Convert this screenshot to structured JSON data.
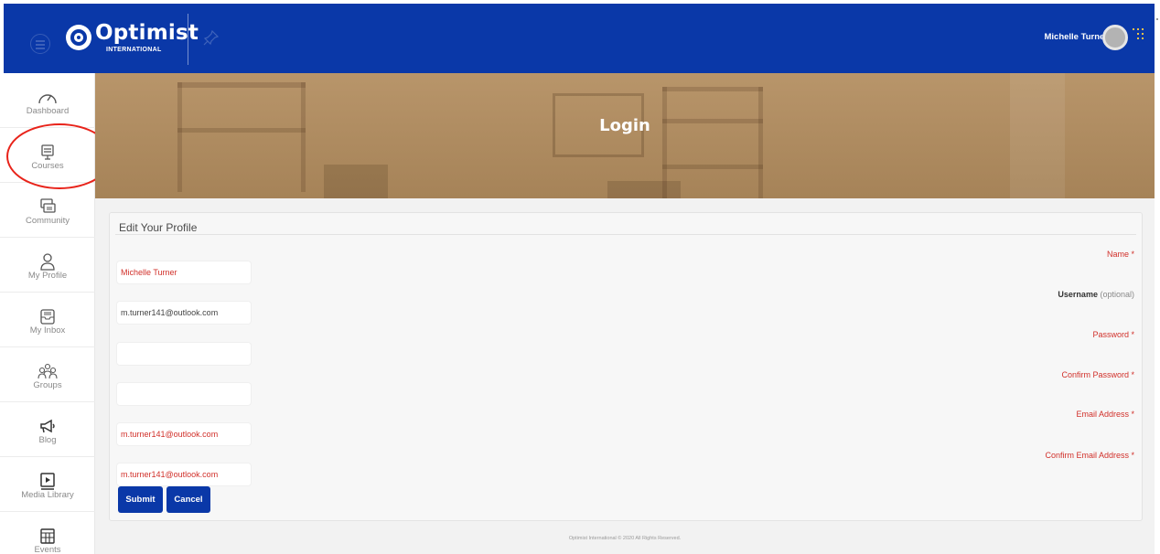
{
  "header": {
    "logo_text": "Optimist",
    "logo_sub": "INTERNATIONAL",
    "user_name": "Michelle Turner",
    "brand_color": "#0a38a8"
  },
  "sidebar": {
    "items": [
      {
        "label": "Dashboard",
        "icon": "gauge-icon"
      },
      {
        "label": "Courses",
        "icon": "monitor-icon"
      },
      {
        "label": "Community",
        "icon": "chat-bubbles-icon"
      },
      {
        "label": "My Profile",
        "icon": "user-icon"
      },
      {
        "label": "My Inbox",
        "icon": "inbox-icon"
      },
      {
        "label": "Groups",
        "icon": "group-icon"
      },
      {
        "label": "Blog",
        "icon": "megaphone-icon"
      },
      {
        "label": "Media Library",
        "icon": "video-library-icon"
      },
      {
        "label": "Events",
        "icon": "calendar-icon"
      }
    ]
  },
  "hero": {
    "title": "Login"
  },
  "form": {
    "title": "Edit Your Profile",
    "fields": {
      "name": "Michelle Turner",
      "username": "m.turner141@outlook.com",
      "password": "",
      "confirm_password": "",
      "email": "m.turner141@outlook.com",
      "confirm_email": "m.turner141@outlook.com"
    },
    "labels": {
      "name": "Name *",
      "username": "Username",
      "username_optional": "(optional)",
      "password": "Password *",
      "confirm_password": "Confirm Password *",
      "email": "Email Address *",
      "confirm_email": "Confirm Email Address *"
    },
    "buttons": {
      "submit": "Submit",
      "cancel": "Cancel"
    }
  },
  "footer": {
    "text": "Optimist International © 2020 All Rights Reserved."
  }
}
